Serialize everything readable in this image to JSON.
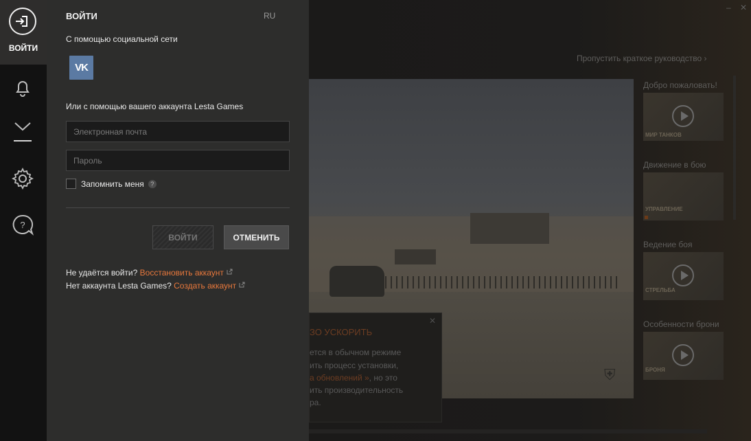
{
  "rail": {
    "login_label": "ВОЙТИ",
    "icons": [
      "login-icon",
      "bell-icon",
      "download-icon",
      "gear-icon",
      "help-icon"
    ]
  },
  "panel": {
    "title": "ВОЙТИ",
    "language": "RU",
    "social_label": "С помощью социальной сети",
    "social_buttons": [
      {
        "name": "vk",
        "label": "VK",
        "color": "#5b7aa3"
      }
    ],
    "account_label": "Или с помощью вашего аккаунта Lesta Games",
    "email_placeholder": "Электронная почта",
    "password_placeholder": "Пароль",
    "remember_label": "Запомнить меня",
    "remember_checked": false,
    "login_button": "ВОЙТИ",
    "cancel_button": "ОТМЕНИТЬ",
    "recover_prompt": "Не удаётся войти?",
    "recover_link": "Восстановить аккаунт",
    "create_prompt": "Нет аккаунта Lesta Games?",
    "create_link": "Создать аккаунт",
    "link_color": "#e8783c"
  },
  "background": {
    "skip_tutorial": "Пропустить краткое руководство ›",
    "tip": {
      "title": "ЗО УСКОРИТЬ",
      "lines": [
        "ется в обычном режиме",
        "ить процесс установки,",
        "а обновлений », но это",
        "ить производительность",
        "ра."
      ],
      "highlight": "а обновлений »"
    },
    "videos": [
      {
        "title": "Добро пожаловать!",
        "caption": "МИР ТАНКОВ"
      },
      {
        "title": "Движение в бою",
        "caption": "УПРАВЛЕНИЕ"
      },
      {
        "title": "Ведение боя",
        "caption": "СТРЕЛЬБА"
      },
      {
        "title": "Особенности брони",
        "caption": "БРОНЯ"
      }
    ]
  }
}
